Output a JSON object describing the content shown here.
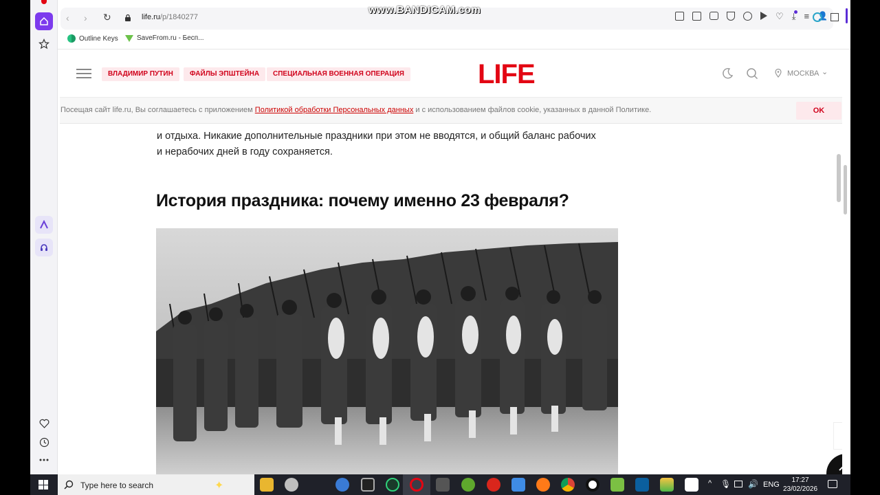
{
  "watermark": "www.BANDICAM.com",
  "browser": {
    "url_domain": "life.ru",
    "url_path": "/p/1840277",
    "bookmarks": [
      {
        "label": "Outline Keys"
      },
      {
        "label": "SaveFrom.ru - Бесп..."
      }
    ]
  },
  "site": {
    "logo": "LIFE",
    "tags": [
      "ВЛАДИМИР ПУТИН",
      "ФАЙЛЫ ЭПШТЕЙНА",
      "СПЕЦИАЛЬНАЯ ВОЕННАЯ ОПЕРАЦИЯ"
    ],
    "city": "МОСКВА",
    "colors": {
      "brand": "#e30613",
      "tag_bg": "#fde9ec"
    }
  },
  "cookie": {
    "text_before": "Посещая сайт life.ru, Вы соглашаетесь с приложением ",
    "link": "Политикой обработки Персональных данных",
    "text_after": " и с использованием файлов cookie, указанных в данной Политике.",
    "ok": "OK"
  },
  "article": {
    "para_line1": "и отдыха. Никакие дополнительные праздники при этом не вводятся, и общий баланс рабочих",
    "para_line2": "и нерабочих дней в году сохраняется.",
    "heading": "История праздника: почему именно 23 февраля?"
  },
  "taskbar": {
    "search_placeholder": "Type here to search",
    "lang": "ENG",
    "time": "17:27",
    "date": "23/02/2026"
  }
}
